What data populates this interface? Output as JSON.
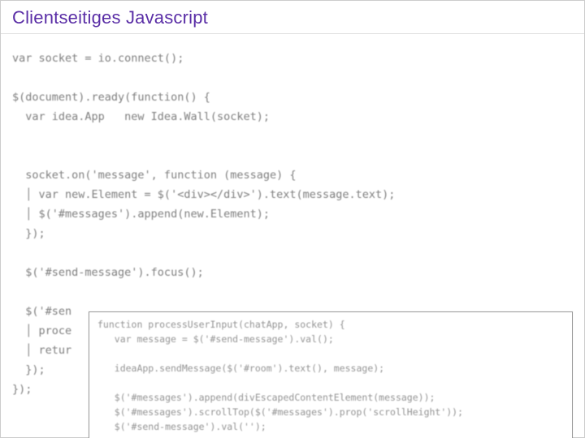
{
  "title": "Clientseitiges Javascript",
  "code": {
    "l01": "var socket = io.connect();",
    "l02": "",
    "l03": "$(document).ready(function() {",
    "l04": "  var idea.App   new Idea.Wall(socket);",
    "l05": "",
    "l06": "",
    "l07": "  socket.on('message', function (message) {",
    "l08": "  │ var new.Element = $('<div></div>').text(message.text);",
    "l09": "  │ $('#messages').append(new.Element);",
    "l10": "  });",
    "l11": "",
    "l12": "  $('#send-message').focus();",
    "l13": "",
    "l14": "  $('#sen",
    "l15": "  │ proce",
    "l16": "  │ retur",
    "l17": "  });",
    "l18": "});"
  },
  "overlay": {
    "o1": "function processUserInput(chatApp, socket) {",
    "o2": "   var message = $('#send-message').val();",
    "o3": "",
    "o4": "   ideaApp.sendMessage($('#room').text(), message);",
    "o5": "",
    "o6": "   $('#messages').append(divEscapedContentElement(message));",
    "o7": "   $('#messages').scrollTop($('#messages').prop('scrollHeight'));",
    "o8": "   $('#send-message').val('');"
  }
}
